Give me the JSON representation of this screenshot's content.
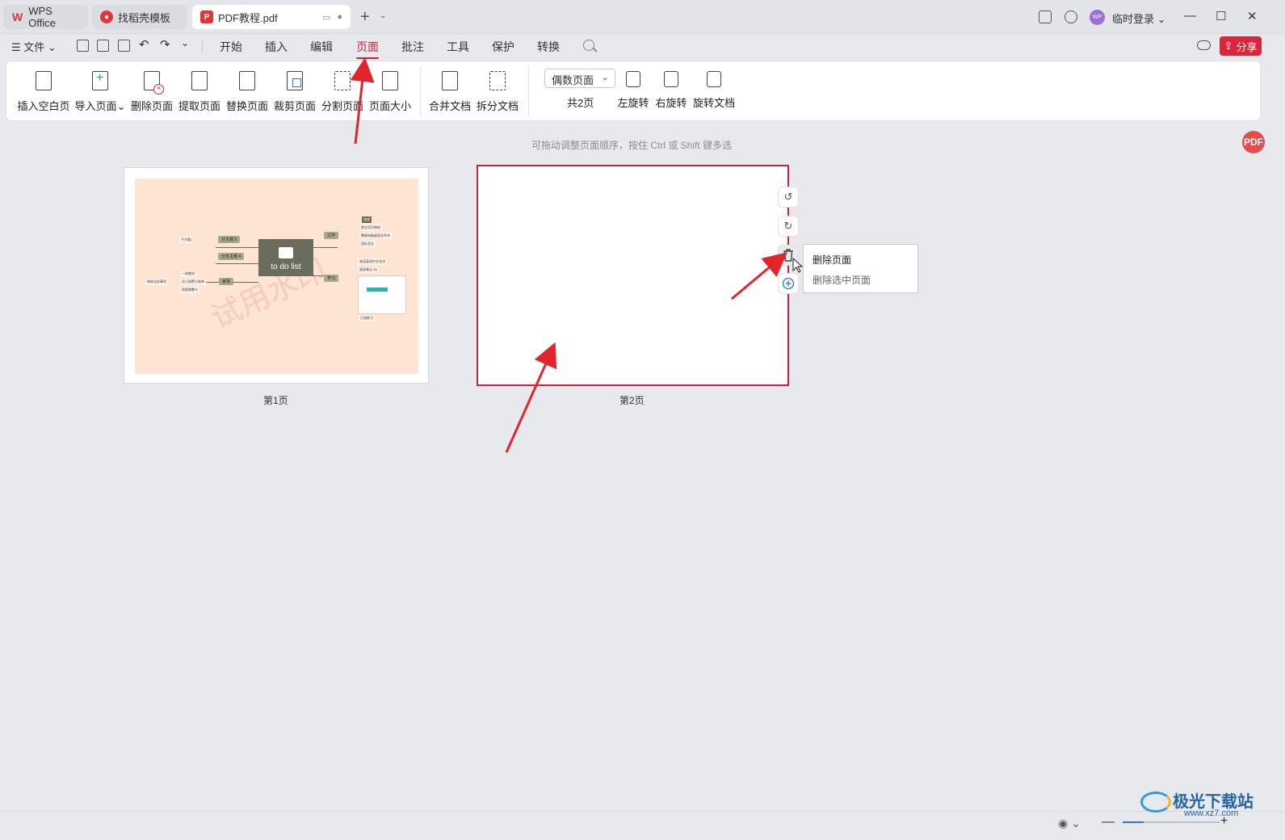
{
  "titlebar": {
    "tabs": [
      {
        "label": "WPS Office"
      },
      {
        "label": "找稻壳模板"
      },
      {
        "label": "PDF教程.pdf"
      }
    ],
    "login_label": "临时登录",
    "avatar_text": "WP"
  },
  "menubar": {
    "file_label": "文件",
    "items": [
      "开始",
      "插入",
      "编辑",
      "页面",
      "批注",
      "工具",
      "保护",
      "转换"
    ],
    "active_item": "页面",
    "share_label": "分享"
  },
  "ribbon": {
    "buttons": [
      {
        "label": "插入空白页",
        "icon": "insert-blank-page-icon"
      },
      {
        "label": "导入页面",
        "icon": "import-page-icon"
      },
      {
        "label": "删除页面",
        "icon": "delete-page-icon"
      },
      {
        "label": "提取页面",
        "icon": "extract-page-icon"
      },
      {
        "label": "替换页面",
        "icon": "replace-page-icon"
      },
      {
        "label": "裁剪页面",
        "icon": "crop-page-icon"
      },
      {
        "label": "分割页面",
        "icon": "split-page-icon"
      },
      {
        "label": "页面大小",
        "icon": "page-size-icon"
      },
      {
        "label": "合并文档",
        "icon": "merge-doc-icon"
      },
      {
        "label": "拆分文档",
        "icon": "split-doc-icon"
      },
      {
        "label": "左旋转",
        "icon": "rotate-left-icon"
      },
      {
        "label": "右旋转",
        "icon": "rotate-right-icon"
      },
      {
        "label": "旋转文档",
        "icon": "rotate-doc-icon"
      }
    ],
    "page_select": "偶数页面",
    "page_count": "共2页"
  },
  "main": {
    "hint": "可拖动调整页面顺序，按住 Ctrl 或 Shift 键多选",
    "pages": [
      {
        "label": "第1页"
      },
      {
        "label": "第2页"
      }
    ],
    "mindmap": {
      "center": "to do list",
      "watermark": "试用水印",
      "nodes": [
        "分主题 5",
        "分支主题 4",
        "工作",
        "学习",
        "家事"
      ],
      "leaves": [
        "子主题1",
        "每周当办事项",
        "一周食材",
        "交订阅费卡账单",
        "周里做整卡",
        "提交项目审核",
        "整理电脑桌面文件夹",
        "团队会议",
        "阅读英语中文名词",
        "阅读笔记 3D",
        "日语练习",
        "完成"
      ]
    },
    "page_tools": {
      "rotate_left": "↺",
      "rotate_right": "↻",
      "delete": "🗑",
      "add": "+"
    },
    "tooltip": {
      "title": "删除页面",
      "desc": "删除选中页面"
    },
    "side_fab": "PDF"
  },
  "watermark_logo": {
    "title": "极光下载站",
    "url": "www.xz7.com"
  },
  "colors": {
    "accent": "#d21f3c",
    "share": "#d9263d",
    "mindmap_bg": "#fde4d3"
  }
}
